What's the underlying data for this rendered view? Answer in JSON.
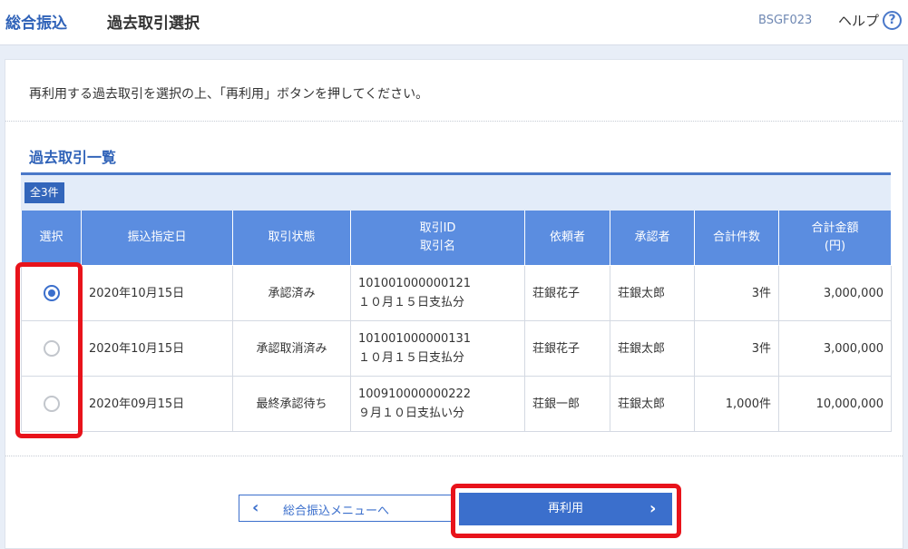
{
  "header": {
    "app_title": "総合振込",
    "page_title": "過去取引選択",
    "screen_id": "BSGF023",
    "help_label": "ヘルプ",
    "help_icon": "question-circle-icon"
  },
  "instruction": "再利用する過去取引を選択の上、「再利用」ボタンを押してください。",
  "section": {
    "title": "過去取引一覧",
    "count_badge": "全3件"
  },
  "table": {
    "headers": {
      "select": "選択",
      "transfer_date": "振込指定日",
      "status": "取引状態",
      "tx_id": "取引ID",
      "tx_name": "取引名",
      "requester": "依頼者",
      "approver": "承認者",
      "total_count": "合計件数",
      "total_amount": "合計金額",
      "amount_unit": "(円)"
    },
    "rows": [
      {
        "selected": true,
        "transfer_date": "2020年10月15日",
        "status": "承認済み",
        "tx_id": "101001000000121",
        "tx_name": "１０月１５日支払分",
        "requester": "荘銀花子",
        "approver": "荘銀太郎",
        "total_count": "3件",
        "total_amount": "3,000,000"
      },
      {
        "selected": false,
        "transfer_date": "2020年10月15日",
        "status": "承認取消済み",
        "tx_id": "101001000000131",
        "tx_name": "１０月１５日支払分",
        "requester": "荘銀花子",
        "approver": "荘銀太郎",
        "total_count": "3件",
        "total_amount": "3,000,000"
      },
      {
        "selected": false,
        "transfer_date": "2020年09月15日",
        "status": "最終承認待ち",
        "tx_id": "100910000000222",
        "tx_name": "９月１０日支払い分",
        "requester": "荘銀一郎",
        "approver": "荘銀太郎",
        "total_count": "1,000件",
        "total_amount": "10,000,000"
      }
    ]
  },
  "buttons": {
    "back_label": "総合振込メニューへ",
    "back_icon": "chevron-left-icon",
    "reuse_label": "再利用",
    "reuse_icon": "chevron-right-icon"
  },
  "colors": {
    "accent": "#3b6fcc",
    "table_header": "#5b8de0",
    "highlight": "#e8131b"
  }
}
